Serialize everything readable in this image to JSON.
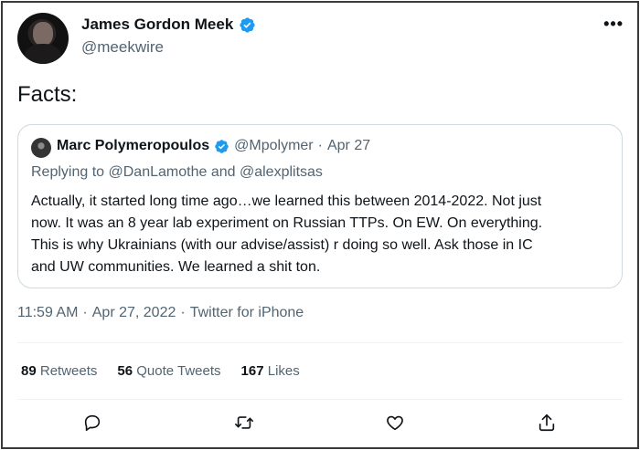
{
  "author": {
    "display_name": "James Gordon Meek",
    "handle": "@meekwire",
    "verified": true
  },
  "tweet": {
    "text": "Facts:",
    "time": "11:59 AM",
    "sep": "·",
    "date": "Apr 27, 2022",
    "source": "Twitter for iPhone"
  },
  "quote": {
    "display_name": "Marc Polymeropoulos",
    "handle": "@Mpolymer",
    "sep": "·",
    "date": "Apr 27",
    "reply_prefix": "Replying to",
    "reply_mention_1": "@DanLamothe",
    "reply_and": "and",
    "reply_mention_2": "@alexplitsas",
    "lines": [
      "Actually, it started long time ago…we learned this between 2014-2022. Not just",
      "now. It was an 8 year lab experiment on Russian TTPs. On EW. On everything.",
      "This is why Ukrainians (with our advise/assist) r doing so well.  Ask those in IC",
      "and UW communities. We learned a shit ton."
    ]
  },
  "stats": {
    "retweets_count": "89",
    "retweets_label": "Retweets",
    "quotes_count": "56",
    "quotes_label": "Quote Tweets",
    "likes_count": "167",
    "likes_label": "Likes"
  },
  "colors": {
    "verified_blue": "#1d9bf0",
    "secondary_text": "#536471",
    "primary_text": "#0f1419"
  },
  "icons": [
    "more-icon",
    "verified-icon",
    "reply-icon",
    "retweet-icon",
    "like-icon",
    "share-icon"
  ]
}
